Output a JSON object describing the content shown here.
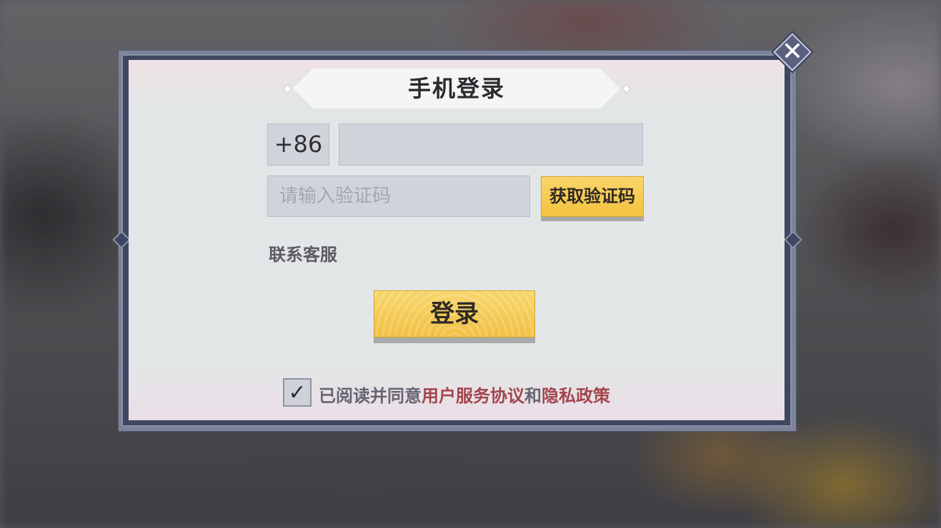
{
  "dialog": {
    "title": "手机登录",
    "close_icon": "close-icon",
    "phone": {
      "country_code": "+86",
      "value": ""
    },
    "verification": {
      "placeholder": "请输入验证码",
      "get_code_label": "获取验证码"
    },
    "support_label": "联系客服",
    "login_label": "登录",
    "agreement": {
      "checked": true,
      "prefix": "已阅读并同意",
      "user_agreement": "用户服务协议",
      "and": "和",
      "privacy_policy": "隐私政策"
    }
  },
  "colors": {
    "accent_gold": "#f3c23f",
    "link_red": "#a4454c",
    "frame": "#3f4660"
  }
}
